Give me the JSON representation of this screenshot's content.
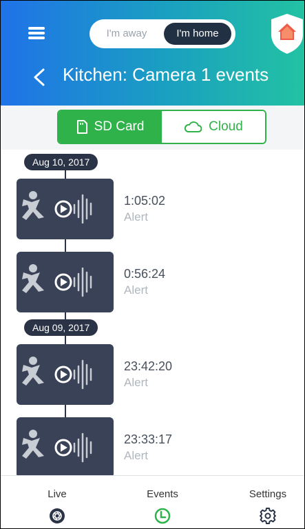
{
  "header": {
    "toggle": {
      "away_label": "I'm away",
      "home_label": "I'm home",
      "selected": "home"
    },
    "title": "Kitchen: Camera 1 events",
    "colors": {
      "gradient_start": "#1f73e8",
      "gradient_end": "#22c2a3"
    }
  },
  "storage_tabs": {
    "sd_label": "SD Card",
    "cloud_label": "Cloud",
    "selected": "sd",
    "accent": "#2fb24a"
  },
  "event_groups": [
    {
      "date": "Aug 10, 2017",
      "events": [
        {
          "time": "1:05:02",
          "type": "Alert"
        },
        {
          "time": "0:56:24",
          "type": "Alert"
        }
      ]
    },
    {
      "date": "Aug 09, 2017",
      "events": [
        {
          "time": "23:42:20",
          "type": "Alert"
        },
        {
          "time": "23:33:17",
          "type": "Alert"
        }
      ]
    }
  ],
  "bottom_nav": {
    "items": [
      {
        "label": "Live",
        "icon": "aperture-icon"
      },
      {
        "label": "Events",
        "icon": "clock-icon",
        "active": true
      },
      {
        "label": "Settings",
        "icon": "gear-icon"
      }
    ],
    "active_color": "#2fb24a"
  }
}
